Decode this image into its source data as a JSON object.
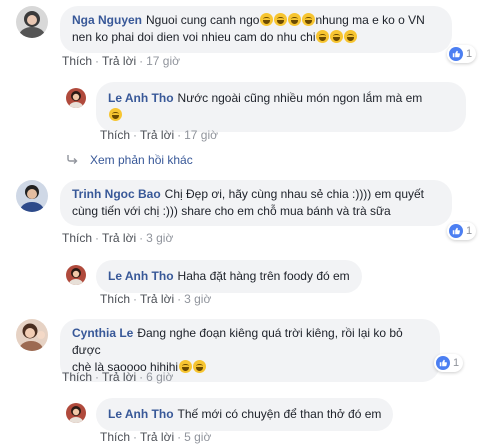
{
  "comments": [
    {
      "author": "Nga Nguyen",
      "text_1": "Nguoi cung canh ngo",
      "text_2": "nhung ma e ko o VN",
      "text_3": "nen ko phai doi dien voi nhieu cam do nhu chi",
      "like": "Thích",
      "reply": "Trả lời",
      "time": "17 giờ",
      "reaction_count": "1"
    },
    {
      "author": "Le Anh Tho",
      "text_1": "Nước ngoài cũng nhiều món ngon lắm mà em",
      "like": "Thích",
      "reply": "Trả lời",
      "time": "17 giờ"
    },
    {
      "author": "Trinh Ngoc Bao",
      "text_1": "Chị Đẹp ơi, hãy cùng nhau sẻ chia :)))) em quyết",
      "text_2": "cùng tiến với chị :))) share cho em chỗ mua bánh và trà sữa",
      "like": "Thích",
      "reply": "Trả lời",
      "time": "3 giờ",
      "reaction_count": "1"
    },
    {
      "author": "Le Anh Tho",
      "text_1": "Haha đặt hàng trên foody đó em",
      "like": "Thích",
      "reply": "Trả lời",
      "time": "3 giờ"
    },
    {
      "author": "Cynthia Le",
      "text_1": "Đang nghe đoạn kiêng quá trời kiêng, rồi lại ko bỏ được",
      "text_2": "chè là saoooo hihihi",
      "like": "Thích",
      "reply": "Trả lời",
      "time": "6 giờ",
      "reaction_count": "1"
    },
    {
      "author": "Le Anh Tho",
      "text_1": "Thế mới có chuyện để than thở đó em",
      "like": "Thích",
      "reply": "Trả lời",
      "time": "5 giờ"
    }
  ],
  "more_replies": "Xem phản hồi khác",
  "colors": {
    "link": "#385898",
    "bubble": "#f2f3f5",
    "like_blue": "#4c7ff2"
  },
  "icons": [
    "like-icon",
    "reply-arrow-icon",
    "laughing-emoji-icon"
  ]
}
